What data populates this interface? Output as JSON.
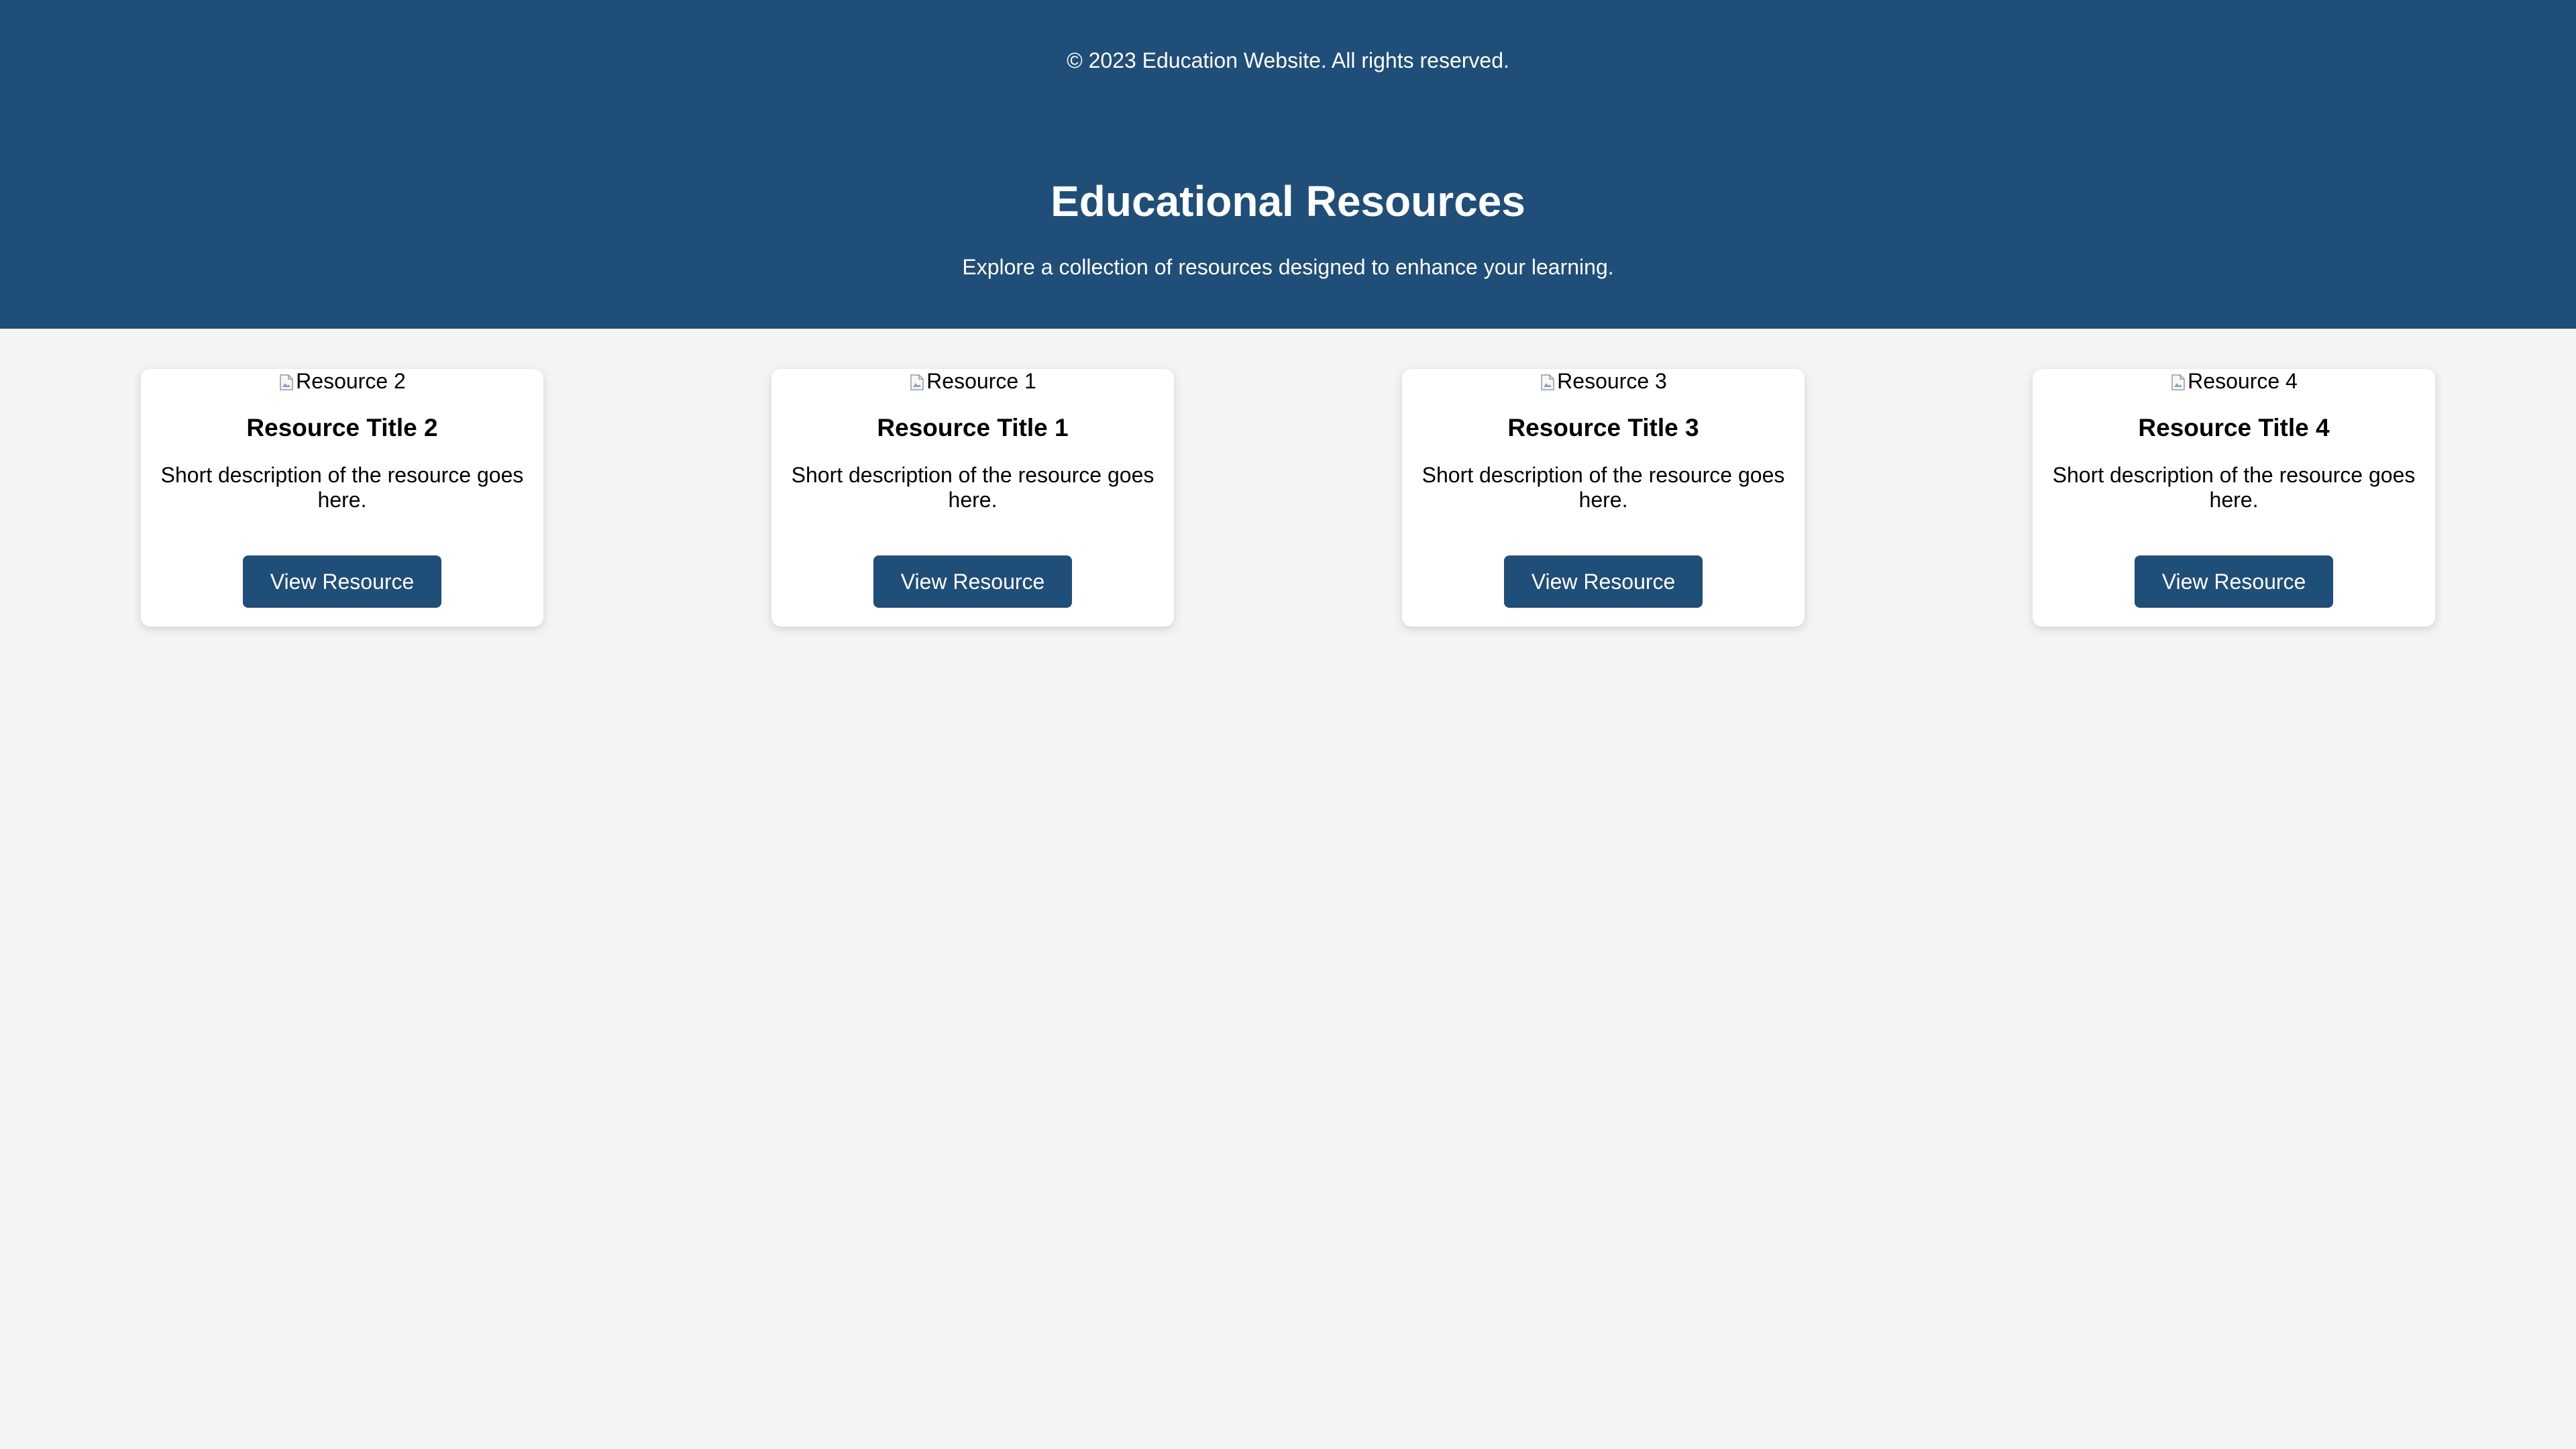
{
  "footer": {
    "copyright": "© 2023 Education Website. All rights reserved."
  },
  "header": {
    "title": "Educational Resources",
    "subtitle": "Explore a collection of resources designed to enhance your learning."
  },
  "colors": {
    "header_background": "#1f4e79",
    "button_background": "#1f4e79",
    "page_background": "#f4f4f4",
    "card_background": "#ffffff"
  },
  "resources": [
    {
      "image_alt": "Resource 2",
      "title": "Resource Title 2",
      "description": "Short description of the resource goes here.",
      "button_label": "View Resource"
    },
    {
      "image_alt": "Resource 1",
      "title": "Resource Title 1",
      "description": "Short description of the resource goes here.",
      "button_label": "View Resource"
    },
    {
      "image_alt": "Resource 3",
      "title": "Resource Title 3",
      "description": "Short description of the resource goes here.",
      "button_label": "View Resource"
    },
    {
      "image_alt": "Resource 4",
      "title": "Resource Title 4",
      "description": "Short description of the resource goes here.",
      "button_label": "View Resource"
    }
  ]
}
